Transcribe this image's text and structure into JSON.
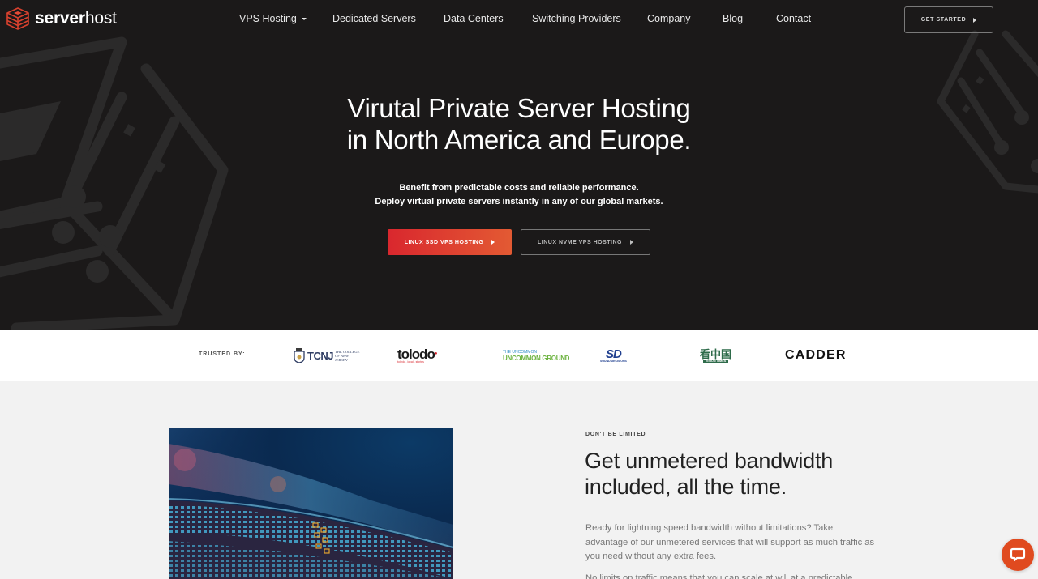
{
  "brand": {
    "name_bold": "server",
    "name_light": "host",
    "accent_color": "#e0322c"
  },
  "nav": {
    "items": [
      {
        "label": "VPS Hosting",
        "has_dropdown": true
      },
      {
        "label": "Dedicated Servers"
      },
      {
        "label": "Data Centers"
      },
      {
        "label": "Switching Providers"
      },
      {
        "label": "Company"
      },
      {
        "label": "Blog"
      },
      {
        "label": "Contact"
      }
    ],
    "cta": "GET STARTED"
  },
  "hero": {
    "title_line1": "Virutal Private Server Hosting",
    "title_line2": "in North America and Europe.",
    "subtitle_line1": "Benefit from predictable costs and reliable performance.",
    "subtitle_line2": "Deploy virtual private servers instantly in any of our global markets.",
    "primary_button": "LINUX SSD VPS HOSTING",
    "secondary_button": "LINUX NVME VPS HOSTING"
  },
  "trusted": {
    "label": "TRUSTED BY:",
    "logos": [
      {
        "name": "TCNJ",
        "sub": "THE COLLEGE OF NEW JERSEY"
      },
      {
        "name": "tolodo",
        "sub": "toledo . local . stories"
      },
      {
        "name": "UNCOMMON GROUND",
        "sub": "THE UNCOMMON"
      },
      {
        "name": "SD",
        "sub": "SOUND DECISIONS"
      },
      {
        "name": "看中国",
        "sub": "VISION TIMES"
      },
      {
        "name": "CADDER"
      }
    ]
  },
  "feature": {
    "eyebrow": "DON'T BE LIMITED",
    "title_line1": "Get unmetered bandwidth",
    "title_line2": "included, all the time.",
    "paragraph1": "Ready for lightning speed bandwidth without limitations? Take advantage of our unmetered services that will support as much traffic as you need without any extra fees.",
    "paragraph2": "No limits on traffic means that you can scale at will at a predictable"
  },
  "chat": {
    "icon": "chat-bubble-icon"
  }
}
